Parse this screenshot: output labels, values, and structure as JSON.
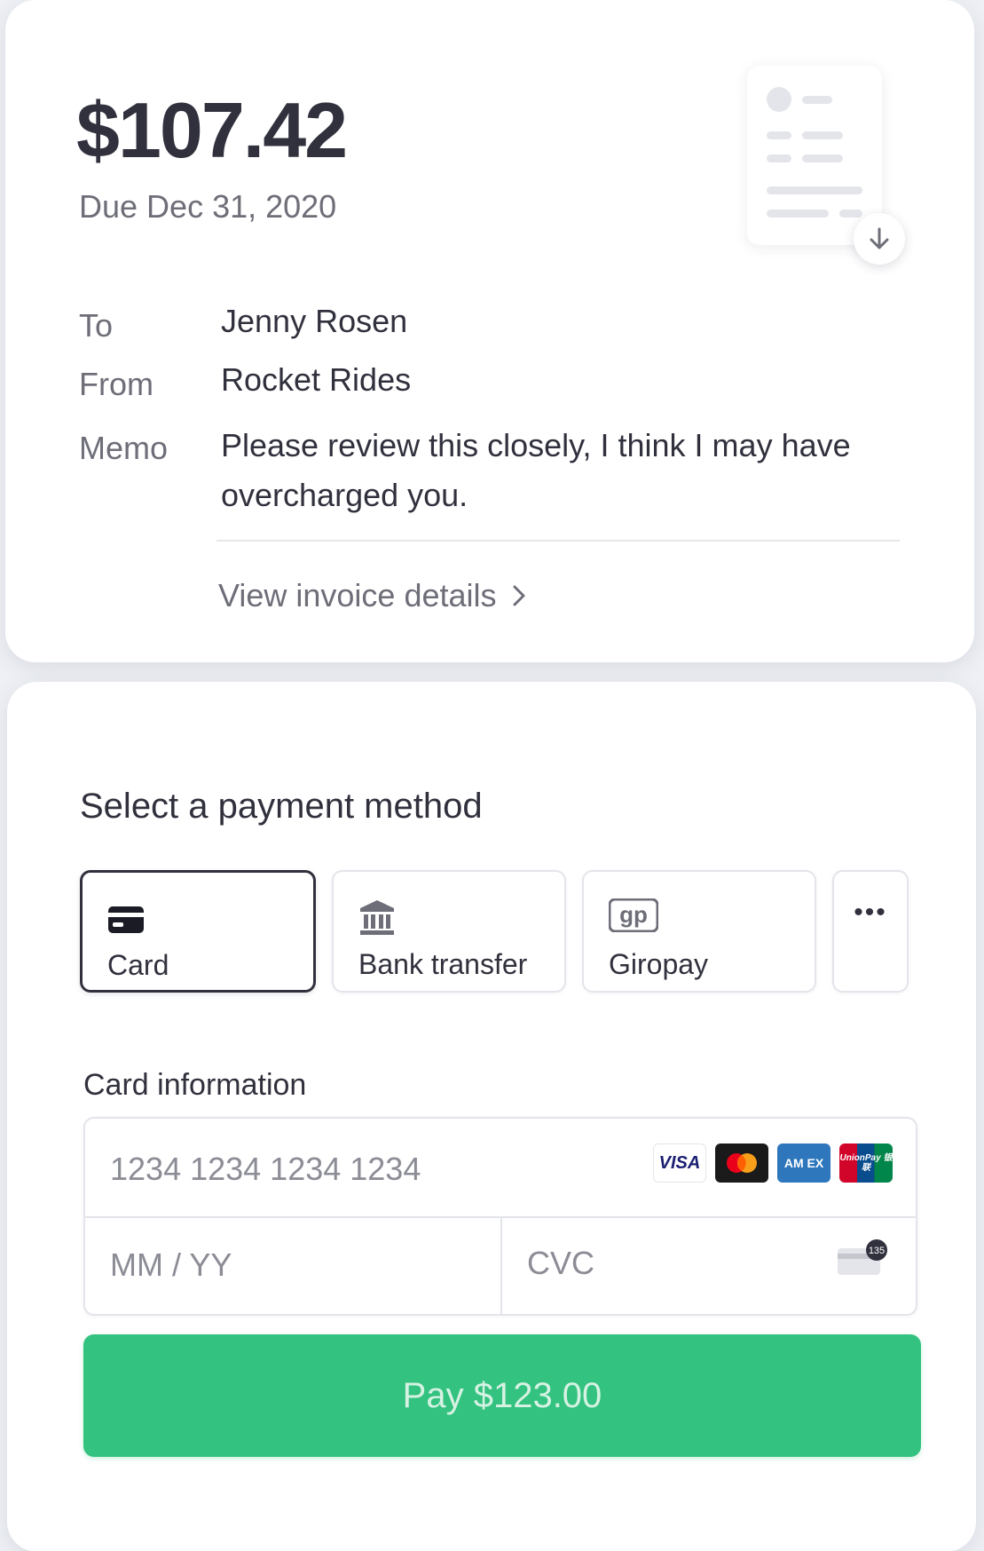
{
  "invoice": {
    "amount": "$107.42",
    "due": "Due Dec 31, 2020",
    "to_label": "To",
    "to_value": "Jenny Rosen",
    "from_label": "From",
    "from_value": "Rocket Rides",
    "memo_label": "Memo",
    "memo_value": "Please review this closely, I think I may have overcharged you.",
    "view_details": "View invoice details",
    "download_icon": "arrow-down-icon"
  },
  "payment": {
    "title": "Select a payment method",
    "methods": [
      {
        "label": "Card",
        "icon": "credit-card-icon",
        "selected": true
      },
      {
        "label": "Bank transfer",
        "icon": "bank-icon",
        "selected": false
      },
      {
        "label": "Giropay",
        "icon": "giropay-icon",
        "selected": false
      }
    ],
    "more_icon": "ellipsis-icon",
    "card_info_label": "Card information",
    "card_number_placeholder": "1234 1234 1234 1234",
    "expiry_placeholder": "MM / YY",
    "cvc_placeholder": "CVC",
    "cvc_hint": "135",
    "brands": [
      {
        "name": "VISA"
      },
      {
        "name": "mastercard"
      },
      {
        "name": "AM EX"
      },
      {
        "name": "UnionPay 银联"
      }
    ],
    "pay_button": "Pay $123.00",
    "colors": {
      "pay_button": "#33c27f",
      "selected_border": "#30313d",
      "muted_text": "#6d6e78"
    }
  }
}
